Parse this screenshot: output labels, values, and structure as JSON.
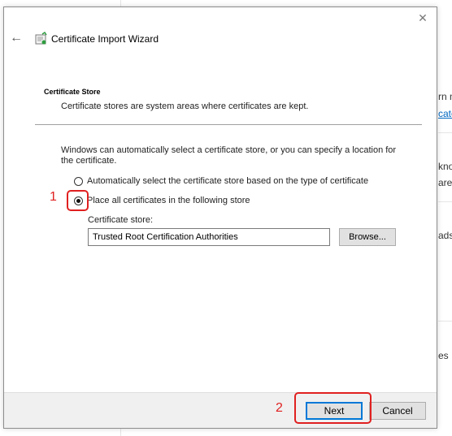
{
  "background_window": {
    "fragments": [
      {
        "text": "rn m",
        "link": false
      },
      {
        "text": "cate",
        "link": true
      },
      {
        "text": "kno",
        "link": false
      },
      {
        "text": "are",
        "link": false
      },
      {
        "text": "ads",
        "link": false
      },
      {
        "text": "es ",
        "link": false
      }
    ]
  },
  "dialog": {
    "title": "Certificate Import Wizard",
    "close_icon": "close-icon",
    "back_icon": "back-arrow-icon",
    "wizard_icon": "certificate-wizard-icon",
    "section_title": "Certificate Store",
    "section_desc": "Certificate stores are system areas where certificates are kept.",
    "intro": "Windows can automatically select a certificate store, or you can specify a location for the certificate.",
    "options": [
      {
        "label": "Automatically select the certificate store based on the type of certificate",
        "checked": false
      },
      {
        "label": "Place all certificates in the following store",
        "checked": true
      }
    ],
    "store_label": "Certificate store:",
    "store_value": "Trusted Root Certification Authorities",
    "browse_label": "Browse...",
    "next_label": "Next",
    "cancel_label": "Cancel"
  },
  "annotations": {
    "step1": "1",
    "step2": "2",
    "color": "#e02020"
  }
}
